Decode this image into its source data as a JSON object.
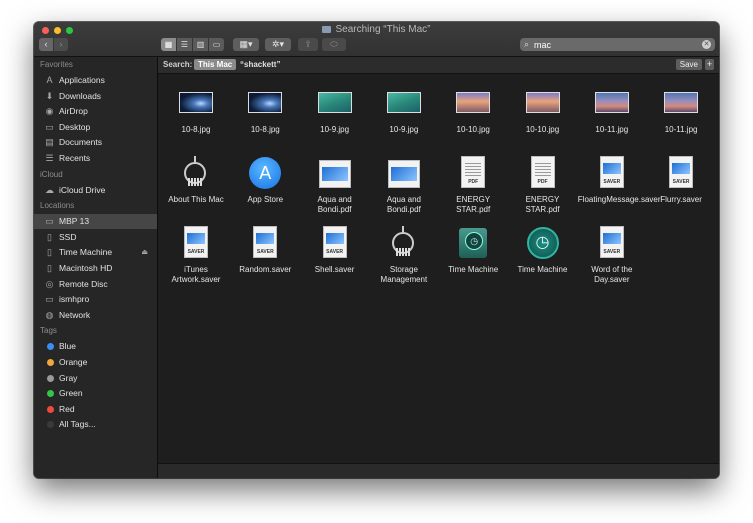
{
  "window": {
    "title": "Searching “This Mac”"
  },
  "toolbar": {
    "back_glyph": "‹",
    "forward_glyph": "›",
    "view_icons": [
      "▦",
      "☰",
      "▥",
      "▭"
    ],
    "group_glyph": "▦▾",
    "action_glyph": "✲▾",
    "share_glyph": "⇪",
    "tag_glyph": "⬭"
  },
  "search": {
    "value": "mac",
    "placeholder": "Search"
  },
  "sidebar": {
    "favorites_heading": "Favorites",
    "favorites": [
      {
        "label": "Applications",
        "icon": "applications-icon",
        "glyph": "A"
      },
      {
        "label": "Downloads",
        "icon": "downloads-icon",
        "glyph": "⬇"
      },
      {
        "label": "AirDrop",
        "icon": "airdrop-icon",
        "glyph": "◉"
      },
      {
        "label": "Desktop",
        "icon": "desktop-icon",
        "glyph": "▭"
      },
      {
        "label": "Documents",
        "icon": "documents-icon",
        "glyph": "▤"
      },
      {
        "label": "Recents",
        "icon": "recents-icon",
        "glyph": "☰"
      }
    ],
    "icloud_heading": "iCloud",
    "icloud": [
      {
        "label": "iCloud Drive",
        "icon": "cloud-icon",
        "glyph": "☁"
      }
    ],
    "locations_heading": "Locations",
    "locations": [
      {
        "label": "MBP 13",
        "icon": "laptop-icon",
        "glyph": "▭",
        "selected": true
      },
      {
        "label": "SSD",
        "icon": "drive-icon",
        "glyph": "▯"
      },
      {
        "label": "Time Machine",
        "icon": "drive-icon",
        "glyph": "▯",
        "eject": "⏏"
      },
      {
        "label": "Macintosh HD",
        "icon": "drive-icon",
        "glyph": "▯"
      },
      {
        "label": "Remote Disc",
        "icon": "disc-icon",
        "glyph": "◎"
      },
      {
        "label": "ismhpro",
        "icon": "display-icon",
        "glyph": "▭"
      },
      {
        "label": "Network",
        "icon": "network-icon",
        "glyph": "◍"
      }
    ],
    "tags_heading": "Tags",
    "tags": [
      {
        "label": "Blue",
        "color": "#3b8df5"
      },
      {
        "label": "Orange",
        "color": "#f3a63c"
      },
      {
        "label": "Gray",
        "color": "#9b9b9b"
      },
      {
        "label": "Green",
        "color": "#33c748"
      },
      {
        "label": "Red",
        "color": "#f2493d"
      },
      {
        "label": "All Tags...",
        "color": "#3a3a3a"
      }
    ]
  },
  "scope": {
    "search_label": "Search:",
    "this_mac": "This Mac",
    "user_scope": "“shackett”",
    "save_label": "Save",
    "add_label": "+"
  },
  "results": [
    {
      "name": "10-8.jpg",
      "kind": "image-thumb",
      "theme": "t-8"
    },
    {
      "name": "10-8.jpg",
      "kind": "image-thumb",
      "theme": "t-8"
    },
    {
      "name": "10-9.jpg",
      "kind": "image-thumb",
      "theme": "t-9"
    },
    {
      "name": "10-9.jpg",
      "kind": "image-thumb",
      "theme": "t-9"
    },
    {
      "name": "10-10.jpg",
      "kind": "image-thumb",
      "theme": "t-10"
    },
    {
      "name": "10-10.jpg",
      "kind": "image-thumb",
      "theme": "t-10"
    },
    {
      "name": "10-11.jpg",
      "kind": "image-thumb",
      "theme": "t-11"
    },
    {
      "name": "10-11.jpg",
      "kind": "image-thumb",
      "theme": "t-11"
    },
    {
      "name": "About This Mac",
      "kind": "gauge"
    },
    {
      "name": "App Store",
      "kind": "appstore",
      "glyph": "A"
    },
    {
      "name": "Aqua and Bondi.pdf",
      "kind": "pdf-art"
    },
    {
      "name": "Aqua and Bondi.pdf",
      "kind": "pdf-art"
    },
    {
      "name": "ENERGY STAR.pdf",
      "kind": "pdf-text",
      "doc_label": "PDF"
    },
    {
      "name": "ENERGY STAR.pdf",
      "kind": "pdf-text",
      "doc_label": "PDF"
    },
    {
      "name": "FloatingMessage.saver",
      "kind": "saver",
      "doc_label": "SAVER"
    },
    {
      "name": "Flurry.saver",
      "kind": "saver",
      "doc_label": "SAVER"
    },
    {
      "name": "iTunes Artwork.saver",
      "kind": "saver",
      "doc_label": "SAVER"
    },
    {
      "name": "Random.saver",
      "kind": "saver",
      "doc_label": "SAVER"
    },
    {
      "name": "Shell.saver",
      "kind": "saver",
      "doc_label": "SAVER"
    },
    {
      "name": "Storage Management",
      "kind": "gauge"
    },
    {
      "name": "Time Machine",
      "kind": "tm-disk",
      "glyph": "◷"
    },
    {
      "name": "Time Machine",
      "kind": "tm-circle",
      "glyph": "◷"
    },
    {
      "name": "Word of the Day.saver",
      "kind": "saver",
      "doc_label": "SAVER"
    }
  ]
}
